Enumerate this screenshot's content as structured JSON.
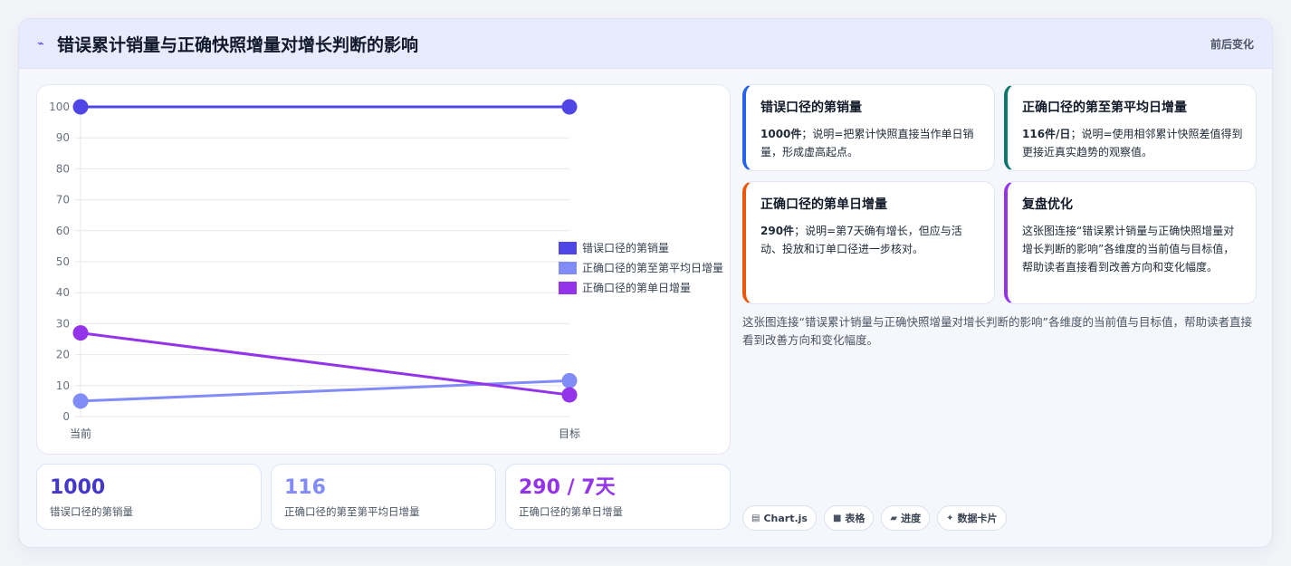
{
  "header": {
    "icon": "trend-icon",
    "title": "错误累计销量与正确快照增量对增长判断的影响",
    "right_label": "前后变化"
  },
  "chart_data": {
    "type": "line",
    "categories": [
      "当前",
      "目标"
    ],
    "ylim": [
      0,
      100
    ],
    "yticks": [
      0,
      10,
      20,
      30,
      40,
      50,
      60,
      70,
      80,
      90,
      100
    ],
    "grid": true,
    "legend": "right",
    "series": [
      {
        "name": "错误口径的第销量",
        "values": [
          100,
          100
        ],
        "color": "#4f46e5"
      },
      {
        "name": "正确口径的第至第平均日增量",
        "values": [
          5,
          11.6
        ],
        "color": "#818cf8"
      },
      {
        "name": "正确口径的第单日增量",
        "values": [
          27,
          7
        ],
        "color": "#9333ea"
      }
    ]
  },
  "stats": [
    {
      "value": "1000",
      "label": "错误口径的第销量",
      "color": "#4338ca"
    },
    {
      "value": "116",
      "label": "正确口径的第至第平均日增量",
      "color": "#818cf8"
    },
    {
      "value": "290 / 7天",
      "label": "正确口径的第单日增量",
      "color": "#9333ea"
    }
  ],
  "cards": [
    {
      "title": "错误口径的第销量",
      "strong": "1000件",
      "body": "；说明=把累计快照直接当作单日销量，形成虚高起点。",
      "accent": "#2563eb"
    },
    {
      "title": "正确口径的第至第平均日增量",
      "strong": "116件/日",
      "body": "；说明=使用相邻累计快照差值得到更接近真实趋势的观察值。",
      "accent": "#0f766e"
    },
    {
      "title": "正确口径的第单日增量",
      "strong": "290件",
      "body": "；说明=第7天确有增长，但应与活动、投放和订单口径进一步核对。",
      "accent": "#ea580c"
    },
    {
      "title": "复盘优化",
      "strong": "",
      "body": "这张图连接“错误累计销量与正确快照增量对增长判断的影响”各维度的当前值与目标值，帮助读者直接看到改善方向和变化幅度。",
      "accent": "#9333ea"
    }
  ],
  "description": "这张图连接“错误累计销量与正确快照增量对增长判断的影响”各维度的当前值与目标值，帮助读者直接看到改善方向和变化幅度。",
  "tags": [
    {
      "icon": "chart-icon",
      "glyph": "▤",
      "label": "Chart.js"
    },
    {
      "icon": "table-icon",
      "glyph": "■",
      "label": "表格"
    },
    {
      "icon": "progress-icon",
      "glyph": "▰",
      "label": "进度"
    },
    {
      "icon": "sparkle-icon",
      "glyph": "✦",
      "label": "数据卡片"
    }
  ]
}
